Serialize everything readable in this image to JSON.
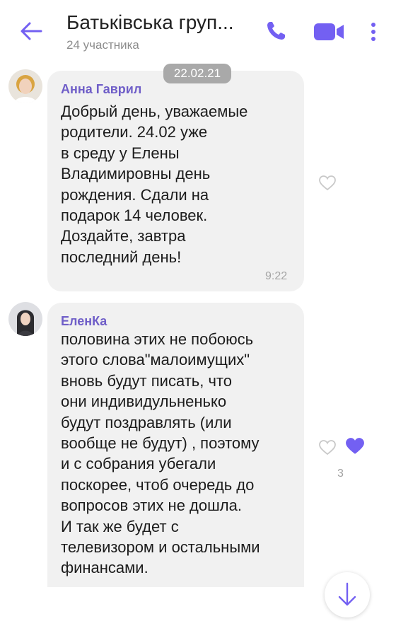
{
  "header": {
    "title": "Батьківська груп...",
    "subtitle": "24 участника",
    "icons": [
      "back-arrow-icon",
      "phone-icon",
      "video-camera-icon",
      "more-vertical-icon"
    ],
    "accent_color": "#7360f2"
  },
  "chat": {
    "date_badge": "22.02.21",
    "messages": [
      {
        "sender": "Анна Гаврил",
        "text": "Добрый день, уважаемые\nродители. 24.02 уже\nв среду у Елены\nВладимировны день\nрождения. Сдали на\nподарок 14 человек.\nДоздайте, завтра\nпоследний день!",
        "time": "9:22"
      },
      {
        "sender": "ЕленКа",
        "text": "половина этих не побоюсь\nэтого слова\"малоимущих\"\nвновь будут писать, что\nони индивидульненько\nбудут поздравлять (или\nвообще не будут) , поэтому\nи с собрания убегали\nпоскорее, чтоб очередь до\nвопросов этих не дошла.\nИ так же будет с\nтелевизором и остальными\nфинансами.",
        "likes": "3"
      }
    ]
  }
}
